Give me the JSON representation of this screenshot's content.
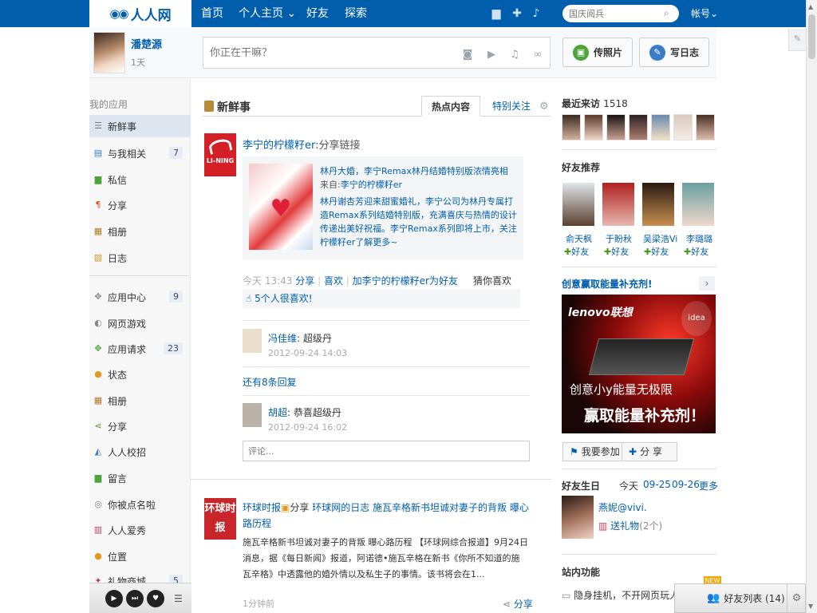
{
  "nav": {
    "logo_text": "人人网",
    "items": [
      "首页",
      "个人主页",
      "好友",
      "探索"
    ],
    "dropdown_glyph": "⌄",
    "search_placeholder": "国庆阅兵",
    "account_label": "帐号⌄"
  },
  "user": {
    "name": "潘楚源",
    "days": "1天"
  },
  "publisher": {
    "placeholder": "你正在干嘛？",
    "photo_button": "传照片",
    "blog_button": "写日志"
  },
  "sidebar": {
    "my_apps_title": "我的应用",
    "items": [
      {
        "label": "新鲜事",
        "count": ""
      },
      {
        "label": "与我相关",
        "count": "7"
      },
      {
        "label": "私信",
        "count": ""
      },
      {
        "label": "分享",
        "count": ""
      },
      {
        "label": "相册",
        "count": ""
      },
      {
        "label": "日志",
        "count": ""
      }
    ],
    "app_items": [
      {
        "label": "应用中心",
        "count": "9"
      },
      {
        "label": "网页游戏",
        "count": ""
      },
      {
        "label": "应用请求",
        "count": "23"
      },
      {
        "label": "状态",
        "count": ""
      },
      {
        "label": "相册",
        "count": ""
      },
      {
        "label": "分享",
        "count": ""
      },
      {
        "label": "人人校招",
        "count": ""
      },
      {
        "label": "留言",
        "count": ""
      },
      {
        "label": "你被点名啦",
        "count": ""
      },
      {
        "label": "人人爱秀",
        "count": ""
      },
      {
        "label": "位置",
        "count": ""
      },
      {
        "label": "礼物商城",
        "count": "5"
      }
    ]
  },
  "feed": {
    "title": "新鲜事",
    "tab_hot": "热点内容",
    "tab_special": "特别关注",
    "post1": {
      "brand": "LI-NING",
      "author": "李宁的柠檬籽er",
      "action": ":分享链接",
      "share_title": "林丹大婚，李宁Remax林丹结婚特别版浓情亮相",
      "share_from_label": "来自:",
      "share_from_name": "李宁的柠檬籽er",
      "share_desc": "林丹谢杏芳迎来甜蜜婚礼，李宁公司为林丹专属打造Remax系列结婚特别版，充满喜庆与热情的设计传递出美好祝福。李宁Remax系列即将上市，关注柠檬籽er了解更多~",
      "time": "今天 13:43",
      "actions": [
        "分享",
        "喜欢",
        "加李宁的柠檬籽er为好友"
      ],
      "guess": "猜你喜欢",
      "likes": "5个人很喜欢!",
      "comments": [
        {
          "name": "冯佳维",
          "text": "超级丹",
          "time": "2012-09-24 14:03"
        },
        {
          "name": "胡超",
          "text": "恭喜超级丹",
          "time": "2012-09-24 16:02"
        }
      ],
      "more_replies": "还有8条回复",
      "comment_placeholder": "评论..."
    },
    "post2": {
      "logo": "环球时报",
      "title_prefix": "环球时报",
      "title_action": "分享",
      "title_link": "环球网的日志 施瓦辛格新书坦诚对妻子的背叛 曝心路历程",
      "body": "施瓦辛格新书坦诚对妻子的背叛 曝心路历程 【环球网综合报道】9月24日消息，据《每日新闻》报道，阿诺德•施瓦辛格在新书《你所不知道的施瓦辛格》中透露他的婚外情以及私生子的事情。该书将会在1...",
      "time": "1分钟前",
      "share": "分享"
    }
  },
  "right": {
    "visitors_title": "最近来访",
    "visitors_count": "1518",
    "rec_title": "好友推荐",
    "recs": [
      {
        "name": "俞天枫"
      },
      {
        "name": "于盼秋"
      },
      {
        "name": "吴梁浩Vic"
      },
      {
        "name": "李璐璐"
      }
    ],
    "add_friend": "好友",
    "ad_title": "创意赢取能量补充剂!",
    "ad_brand": "lenovo联想",
    "ad_line1": "创意小y能量无极限",
    "ad_line2": "赢取能量补充剂！",
    "ad_tag": "idea",
    "ad_join": "我要参加",
    "ad_share": "分 享",
    "bday_title": "好友生日",
    "bday_tabs": [
      "今天",
      "09-25",
      "09-26",
      "更多"
    ],
    "bday_name": "燕妮@vivi.",
    "bday_gift": "送礼物",
    "bday_gift_count": "(2个)",
    "site_title": "站内功能",
    "site_item": "隐身挂机，不开网页玩人人-人",
    "new_tag": "NEW",
    "friend_list": "好友列表 (14)"
  },
  "colors": {
    "brand": "#005eac",
    "lining": "#d51f26",
    "hq": "#c8262b"
  }
}
